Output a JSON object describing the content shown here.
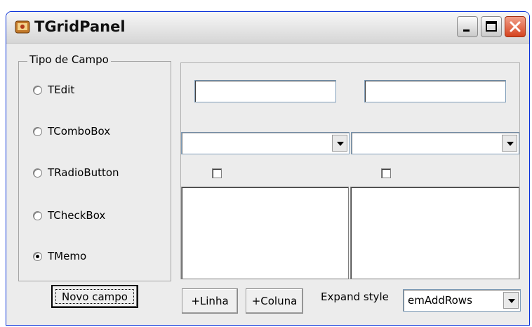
{
  "window": {
    "title": "TGridPanel",
    "controls": {
      "minimize": "minimize",
      "maximize": "maximize",
      "close": "close"
    }
  },
  "field_type_group": {
    "label": "Tipo de Campo",
    "options": [
      {
        "label": "TEdit",
        "selected": false
      },
      {
        "label": "TComboBox",
        "selected": false
      },
      {
        "label": "TRadioButton",
        "selected": false
      },
      {
        "label": "TCheckBox",
        "selected": false
      },
      {
        "label": "TMemo",
        "selected": true
      }
    ],
    "new_field_button": "Novo campo"
  },
  "grid_panel": {
    "edits": [
      "",
      ""
    ],
    "combos": [
      "",
      ""
    ],
    "checkboxes": [
      false,
      false
    ],
    "memos": [
      "",
      ""
    ]
  },
  "toolbar": {
    "add_row_button": "+Linha",
    "add_column_button": "+Coluna",
    "expand_style_label": "Expand style",
    "expand_style_value": "emAddRows"
  },
  "colors": {
    "titlebar_accent": "#0831d9",
    "close_button": "#d5431f",
    "face": "#ececec"
  }
}
